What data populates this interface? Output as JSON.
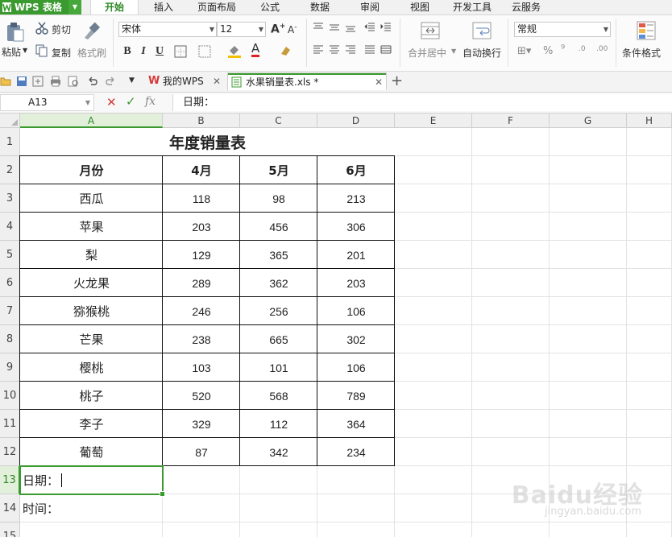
{
  "app": {
    "name": "WPS 表格"
  },
  "menu_tabs": [
    "开始",
    "插入",
    "页面布局",
    "公式",
    "数据",
    "审阅",
    "视图",
    "开发工具",
    "云服务"
  ],
  "active_menu_tab": "开始",
  "ribbon": {
    "paste": "粘贴",
    "cut": "剪切",
    "copy": "复制",
    "format_painter": "格式刷",
    "font_name": "宋体",
    "font_size": "12",
    "merge_center": "合并居中",
    "wrap_text": "自动换行",
    "number_format": "常规",
    "conditional_format": "条件格式",
    "bold": "B",
    "italic": "I",
    "underline": "U"
  },
  "doc_tabs": [
    {
      "label": "我的WPS"
    },
    {
      "label": "水果销量表.xls *"
    }
  ],
  "formula_bar": {
    "name_box": "A13",
    "fx": "fx",
    "content": "日期："
  },
  "columns": [
    "A",
    "B",
    "C",
    "D",
    "E",
    "F",
    "G",
    "H"
  ],
  "rows": [
    "1",
    "2",
    "3",
    "4",
    "5",
    "6",
    "7",
    "8",
    "9",
    "10",
    "11",
    "12",
    "13",
    "14",
    "15"
  ],
  "sheet": {
    "title": "年度销量表",
    "headers": [
      "月份",
      "4月",
      "5月",
      "6月"
    ],
    "data": [
      [
        "西瓜",
        "118",
        "98",
        "213"
      ],
      [
        "苹果",
        "203",
        "456",
        "306"
      ],
      [
        "梨",
        "129",
        "365",
        "201"
      ],
      [
        "火龙果",
        "289",
        "362",
        "203"
      ],
      [
        "猕猴桃",
        "246",
        "256",
        "106"
      ],
      [
        "芒果",
        "238",
        "665",
        "302"
      ],
      [
        "樱桃",
        "103",
        "101",
        "106"
      ],
      [
        "桃子",
        "520",
        "568",
        "789"
      ],
      [
        "李子",
        "329",
        "112",
        "364"
      ],
      [
        "葡萄",
        "87",
        "342",
        "234"
      ]
    ],
    "a13": "日期：",
    "a14": "时间："
  },
  "watermark": {
    "main": "Baidu经验",
    "sub": "jingyan.baidu.com"
  },
  "colors": {
    "accent": "#3b9a2f",
    "font_color": "#e02020"
  }
}
